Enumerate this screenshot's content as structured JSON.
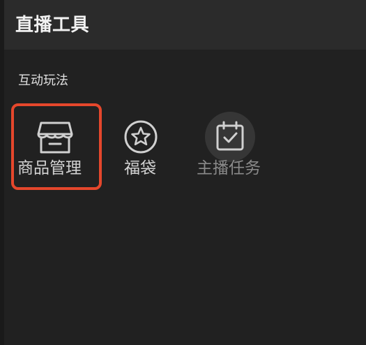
{
  "header": {
    "title": "直播工具"
  },
  "section": {
    "title": "互动玩法"
  },
  "tools": [
    {
      "label": "商品管理",
      "icon": "storefront-icon",
      "selected": true,
      "enabled": true
    },
    {
      "label": "福袋",
      "icon": "star-circle-icon",
      "selected": false,
      "enabled": true
    },
    {
      "label": "主播任务",
      "icon": "calendar-check-icon",
      "selected": false,
      "enabled": false
    }
  ],
  "colors": {
    "highlight_border": "#e5472c",
    "header_bg": "#2b2b2b",
    "panel_bg": "#212121"
  }
}
